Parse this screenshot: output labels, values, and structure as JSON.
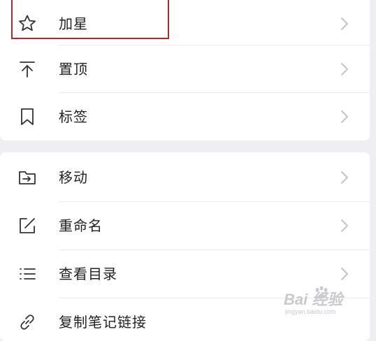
{
  "menu_top": {
    "items": [
      {
        "label": "加星",
        "icon": "star-icon"
      },
      {
        "label": "置顶",
        "icon": "pin-top-icon"
      },
      {
        "label": "标签",
        "icon": "bookmark-icon"
      }
    ]
  },
  "menu_bottom": {
    "items": [
      {
        "label": "移动",
        "icon": "move-folder-icon"
      },
      {
        "label": "重命名",
        "icon": "rename-icon"
      },
      {
        "label": "查看目录",
        "icon": "list-icon"
      },
      {
        "label": "复制笔记链接",
        "icon": "link-icon"
      }
    ]
  },
  "annotation": {
    "highlighted_item": "加星",
    "color": "#b5262c"
  },
  "watermark": {
    "main": "Bai 经验",
    "sub": "jingyan.baidu.com"
  },
  "colors": {
    "background": "#efeef3",
    "card": "#ffffff",
    "text": "#222222",
    "icon": "#333333",
    "chevron": "#c4c4c8"
  }
}
